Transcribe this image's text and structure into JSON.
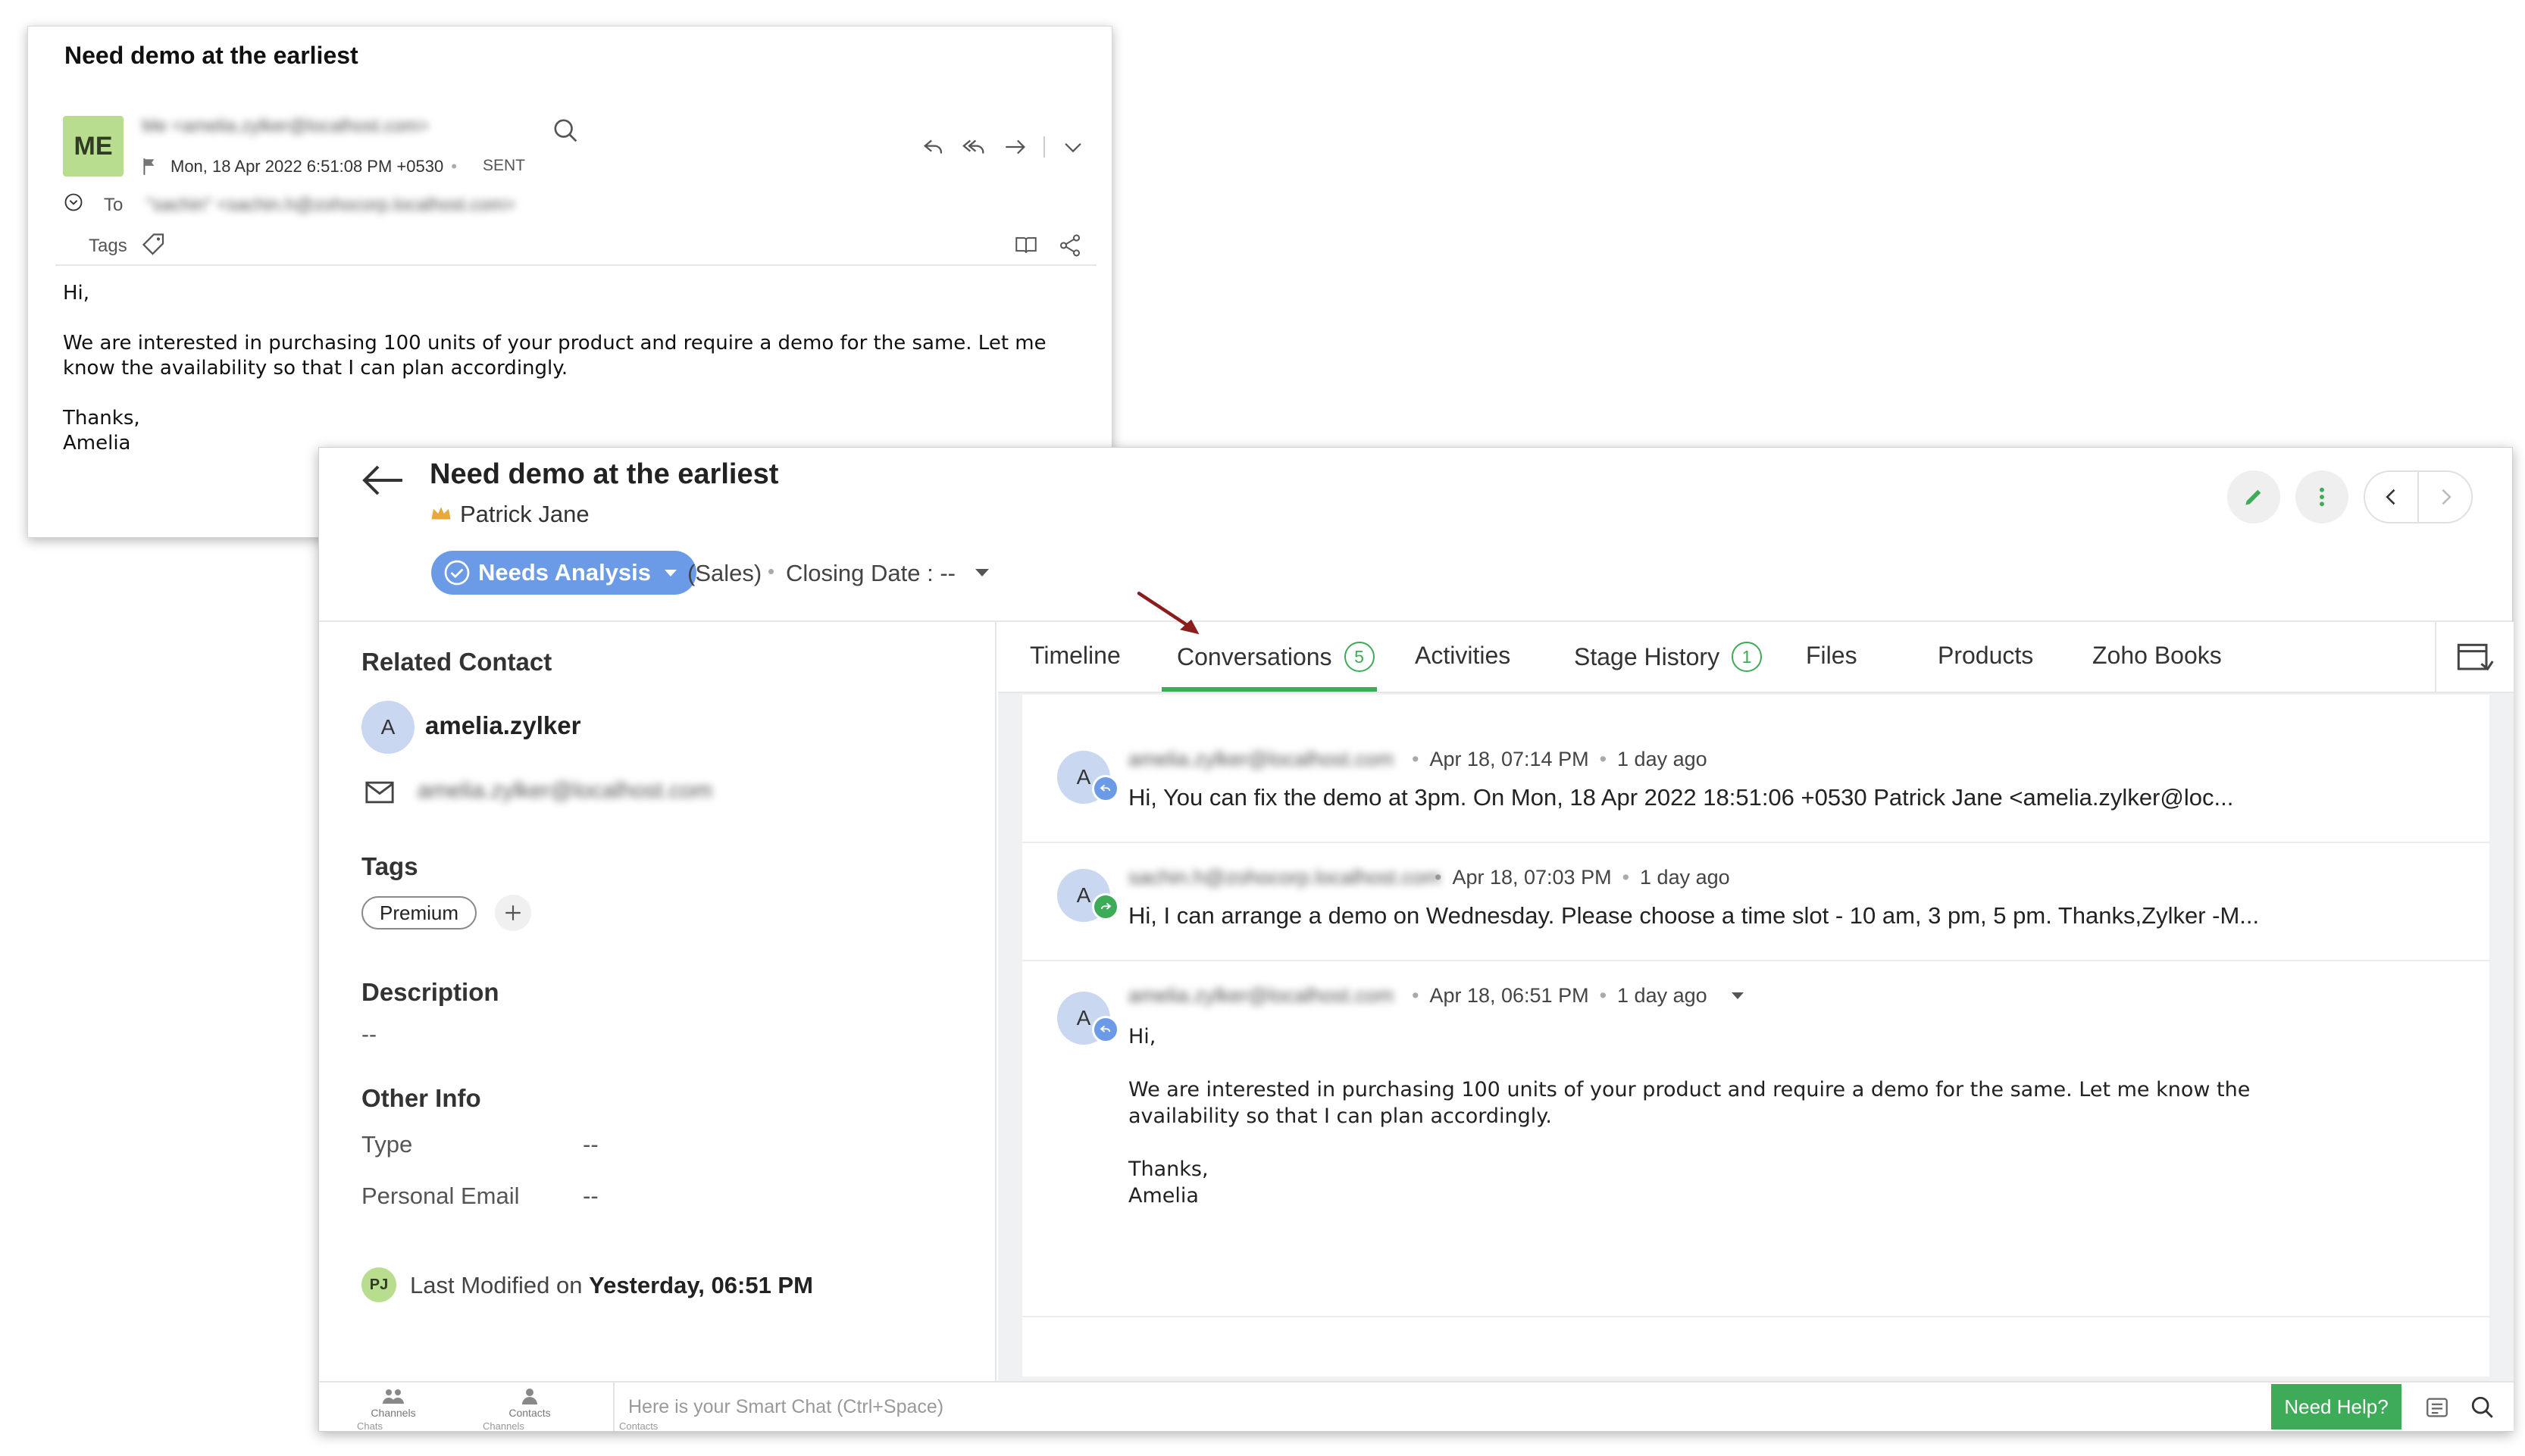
{
  "email": {
    "subject": "Need demo at the earliest",
    "avatar": "ME",
    "from": "Me <amelia.zylker@localhost.com>",
    "date": "Mon, 18 Apr 2022 6:51:08 PM +0530",
    "status": "SENT",
    "to_label": "To",
    "to_value": "\"sachin\" <sachin.h@zohocorp.localhost.com>",
    "tags_label": "Tags",
    "body": {
      "greeting": "Hi,",
      "paragraph": "We are interested in purchasing 100 units of your product and require a demo for the same. Let me know the availability so that I can plan accordingly.",
      "signoff": "Thanks,",
      "signature": "Amelia"
    }
  },
  "deal": {
    "title": "Need demo at the earliest",
    "owner": "Patrick Jane",
    "stage": "Needs Analysis",
    "pipeline": "(Sales)",
    "closing_date": "Closing Date : --"
  },
  "left_panel": {
    "related_contact_title": "Related Contact",
    "contact_avatar": "A",
    "contact_name": "amelia.zylker",
    "contact_email": "amelia.zylker@localhost.com",
    "tags_title": "Tags",
    "tag": "Premium",
    "description_title": "Description",
    "description_value": "--",
    "other_info_title": "Other Info",
    "other_info": [
      {
        "label": "Type",
        "value": "--"
      },
      {
        "label": "Personal Email",
        "value": "--"
      }
    ],
    "modifier_avatar": "PJ",
    "last_modified_label": "Last Modified on",
    "last_modified_value": "Yesterday, 06:51 PM"
  },
  "tabs": [
    {
      "label": "Timeline"
    },
    {
      "label": "Conversations",
      "badge": "5"
    },
    {
      "label": "Activities"
    },
    {
      "label": "Stage History",
      "badge": "1"
    },
    {
      "label": "Files"
    },
    {
      "label": "Products"
    },
    {
      "label": "Zoho Books"
    }
  ],
  "conversations": [
    {
      "avatar": "A",
      "sender": "amelia.zylker@localhost.com",
      "time": "Apr 18, 07:14 PM",
      "ago": "1 day ago",
      "preview": "Hi, You can fix the demo at 3pm. On Mon, 18 Apr 2022 18:51:06 +0530 Patrick Jane <amelia.zylker@loc..."
    },
    {
      "avatar": "A",
      "sender": "sachin.h@zohocorp.localhost.com",
      "time": "Apr 18, 07:03 PM",
      "ago": "1 day ago",
      "preview": "Hi, I can arrange a demo on Wednesday. Please choose a time slot - 10 am, 3 pm, 5 pm. Thanks,Zylker -M..."
    },
    {
      "avatar": "A",
      "sender": "amelia.zylker@localhost.com",
      "time": "Apr 18, 06:51 PM",
      "ago": "1 day ago",
      "greeting": "Hi,",
      "paragraph": "We are interested in purchasing 100 units of your product and require a demo for the same. Let me know the availability so that I can plan accordingly.",
      "signoff": "Thanks,",
      "signature": "Amelia"
    }
  ],
  "bottom_bar": {
    "channels": "Channels",
    "contacts": "Contacts",
    "chats_sub": "Chats",
    "channels_sub": "Channels",
    "contacts_sub": "Contacts",
    "smart_chat_placeholder": "Here is your Smart Chat (Ctrl+Space)",
    "need_help": "Need Help?"
  },
  "colors": {
    "accent_green": "#3dab57",
    "stage_blue": "#6b9be6",
    "avatar_green": "#b9dd8e",
    "avatar_blue": "#cad7f1",
    "annotation_arrow": "#8b1d1d"
  }
}
